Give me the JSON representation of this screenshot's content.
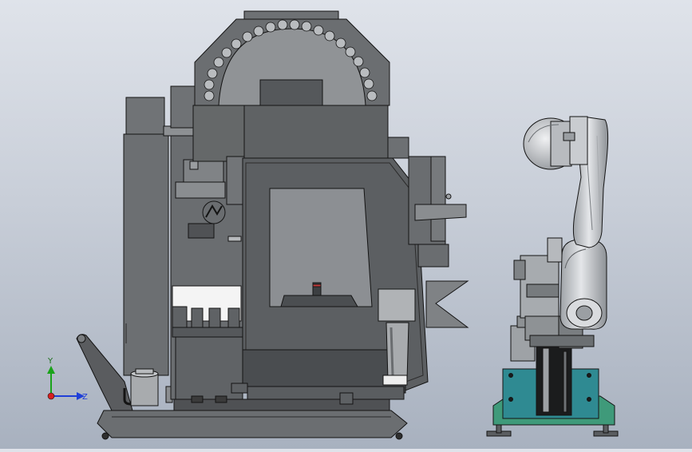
{
  "viewport": {
    "background_top": "#dfe3ea",
    "background_bottom": "#a8b1bf"
  },
  "triad": {
    "y_label": "Y",
    "z_label": "Z",
    "y_color": "#1aa31a",
    "z_color": "#1f3fd8",
    "origin_color": "#d81f1f"
  },
  "colors": {
    "machine_dark": "#5d5f62",
    "machine_mid": "#76797c",
    "machine_light": "#a4a7aa",
    "outline": "#141414",
    "robot_silver": "#c9ccd0",
    "robot_base_teal": "#2f8a92",
    "robot_feet_green": "#3f9a7a",
    "window_glass": "#8c8f93"
  }
}
